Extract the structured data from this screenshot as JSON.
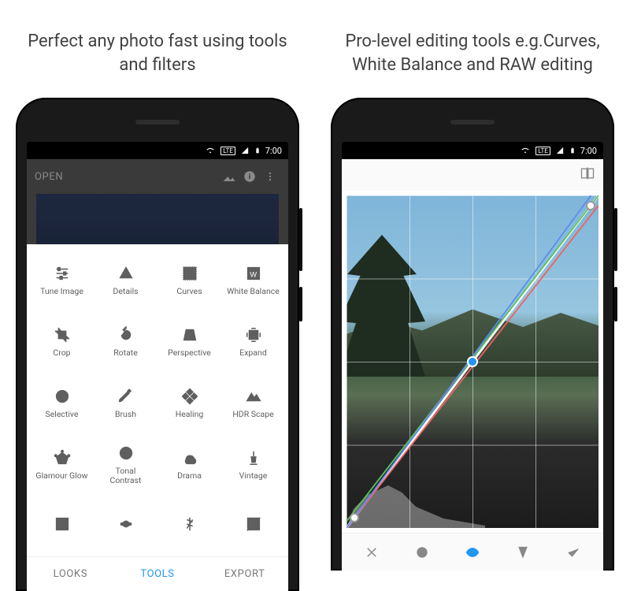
{
  "captions": {
    "left": "Perfect any photo fast using tools and filters",
    "right": "Pro-level editing tools e.g.Curves, White Balance and RAW editing"
  },
  "status": {
    "time": "7:00",
    "network": "LTE"
  },
  "screen1": {
    "open_label": "OPEN",
    "tools": [
      {
        "id": "tune-image",
        "label": "Tune Image"
      },
      {
        "id": "details",
        "label": "Details"
      },
      {
        "id": "curves",
        "label": "Curves"
      },
      {
        "id": "white-balance",
        "label": "White Balance"
      },
      {
        "id": "crop",
        "label": "Crop"
      },
      {
        "id": "rotate",
        "label": "Rotate"
      },
      {
        "id": "perspective",
        "label": "Perspective"
      },
      {
        "id": "expand",
        "label": "Expand"
      },
      {
        "id": "selective",
        "label": "Selective"
      },
      {
        "id": "brush",
        "label": "Brush"
      },
      {
        "id": "healing",
        "label": "Healing"
      },
      {
        "id": "hdr-scape",
        "label": "HDR Scape"
      },
      {
        "id": "glamour-glow",
        "label": "Glamour Glow"
      },
      {
        "id": "tonal-contrast",
        "label": "Tonal Contrast"
      },
      {
        "id": "drama",
        "label": "Drama"
      },
      {
        "id": "vintage",
        "label": "Vintage"
      },
      {
        "id": "grainy-film",
        "label": ""
      },
      {
        "id": "retrolux",
        "label": ""
      },
      {
        "id": "grunge",
        "label": ""
      },
      {
        "id": "black-white",
        "label": ""
      }
    ],
    "tabs": {
      "looks": "LOOKS",
      "tools": "TOOLS",
      "export": "EXPORT",
      "active": "tools"
    }
  },
  "screen2": {
    "channels": [
      "luminance",
      "red",
      "green",
      "blue"
    ],
    "active_channel": "luminance",
    "curve_points": [
      {
        "x": 0.0,
        "y": 1.0
      },
      {
        "x": 0.5,
        "y": 0.5,
        "active": true
      },
      {
        "x": 1.0,
        "y": 0.0
      }
    ]
  }
}
